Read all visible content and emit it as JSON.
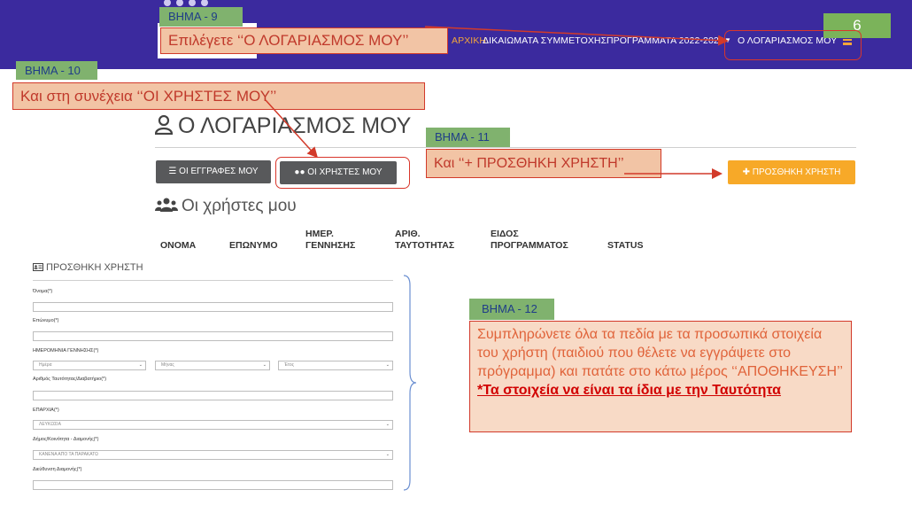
{
  "nav": {
    "menu_partial": "ΑΡΧΙΚΗ",
    "menu_participation": "ΔΙΚΑΙΩΜΑΤΑ ΣΥΜΜΕΤΟΧΗΣ",
    "menu_programs": "ΠΡΟΓΡΑΜΜΑΤΑ 2022-2023",
    "menu_account": "Ο ΛΟΓΑΡΙΑΣΜΟΣ ΜΟΥ",
    "colors": {
      "nav_bg": "#3b2a9e",
      "accent": "#f3a53a"
    }
  },
  "annotations": {
    "step9_tag": "ΒΗΜΑ - 9",
    "step9_text": "Επιλέγετε ‘‘Ο ΛΟΓΑΡΙΑΣΜΟΣ ΜΟΥ’’",
    "step10_tag": "ΒΗΜΑ - 10",
    "step10_text": "Και στη συνέχεια ‘‘ΟΙ ΧΡΗΣΤΕΣ ΜΟΥ’’",
    "step11_tag": "ΒΗΜΑ - 11",
    "step11_text": "Και ‘‘+ ΠΡΟΣΘΗΚΗ ΧΡΗΣΤΗ’’",
    "step12_tag": "ΒΗΜΑ - 12",
    "step12_text": "Συμπληρώνετε όλα τα πεδία με τα προσωπικά στοιχεία του χρήστη (παιδιού που θέλετε να εγγράψετε στο πρόγραμμα) και πατάτε στο κάτω μέρος ‘‘ΑΠΟΘΗΚΕΥΣΗ’’",
    "step12_warning": "*Τα στοιχεία να είναι τα ίδια με την Ταυτότητα",
    "slide_number": "6",
    "colors": {
      "step_tag_bg": "#80b26e",
      "callout_red": "#d23a2a"
    }
  },
  "page": {
    "title": "Ο ΛΟΓΑΡΙΑΣΜΟΣ ΜΟΥ",
    "btn_my_registrations": "ΟΙ ΕΓΓΡΑΦΕΣ ΜΟΥ",
    "btn_my_users": "ΟΙ ΧΡΗΣΤΕΣ ΜΟΥ",
    "btn_add_user": "ΠΡΟΣΘΗΚΗ ΧΡΗΣΤΗ",
    "section_title": "Οι χρήστες μου",
    "columns": [
      "ΟΝΟΜΑ",
      "ΕΠΩΝΥΜΟ",
      "ΗΜΕΡ. ΓΕΝΝΗΣΗΣ",
      "ΑΡΙΘ. ΤΑΥΤΟΤΗΤΑΣ",
      "ΕΙΔΟΣ ΠΡΟΓΡΑΜΜΑΤΟΣ",
      "STATUS"
    ]
  },
  "form": {
    "heading": "ΠΡΟΣΘΗΚΗ ΧΡΗΣΤΗ",
    "label_first_name": "Όνομα(*)",
    "label_last_name": "Επώνυμο(*)",
    "label_birthdate": "ΗΜΕΡΟΜΗΝΙΑ ΓΕΝΝΗΣΗΣ(*)",
    "day_placeholder": "Ημέρα",
    "month_placeholder": "Μήνας",
    "year_placeholder": "Έτος",
    "label_id": "Αριθμός Ταυτότητας/Διαβατήριο(*)",
    "label_district": "ΕΠΑΡΧΙΑ(*)",
    "district_value": "ΛΕΥΚΩΣΙΑ",
    "label_municipality": "Δήμος/Κοινότητα - Διαμονής(*)",
    "municipality_value": "ΚΑΝΕΝΑ ΑΠΟ ΤΑ ΠΑΡΑΚΑΤΩ",
    "label_address": "Διεύθυνση Διαμονής(*)"
  }
}
